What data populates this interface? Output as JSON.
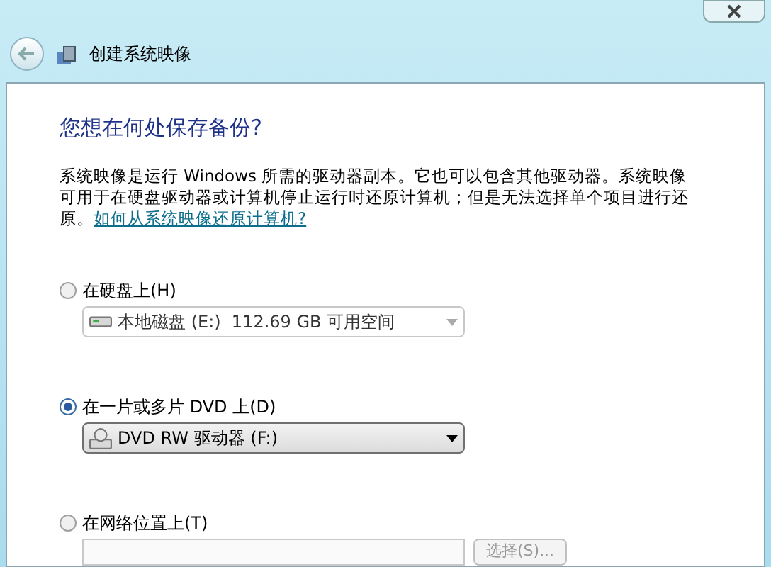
{
  "window": {
    "title": "创建系统映像"
  },
  "heading": "您想在何处保存备份?",
  "description": "系统映像是运行 Windows 所需的驱动器副本。它也可以包含其他驱动器。系统映像可用于在硬盘驱动器或计算机停止运行时还原计算机；但是无法选择单个项目进行还原。",
  "help_link": "如何从系统映像还原计算机?",
  "options": [
    {
      "label": "在硬盘上(H)",
      "selected": false,
      "kind": "dropdown",
      "value": "本地磁盘 (E:)  112.69 GB 可用空间",
      "disabled": true
    },
    {
      "label": "在一片或多片 DVD 上(D)",
      "selected": true,
      "kind": "dropdown",
      "value": "DVD RW 驱动器 (F:)",
      "disabled": false
    },
    {
      "label": "在网络位置上(T)",
      "selected": false,
      "kind": "input",
      "button": "选择(S)...",
      "disabled": true
    }
  ]
}
